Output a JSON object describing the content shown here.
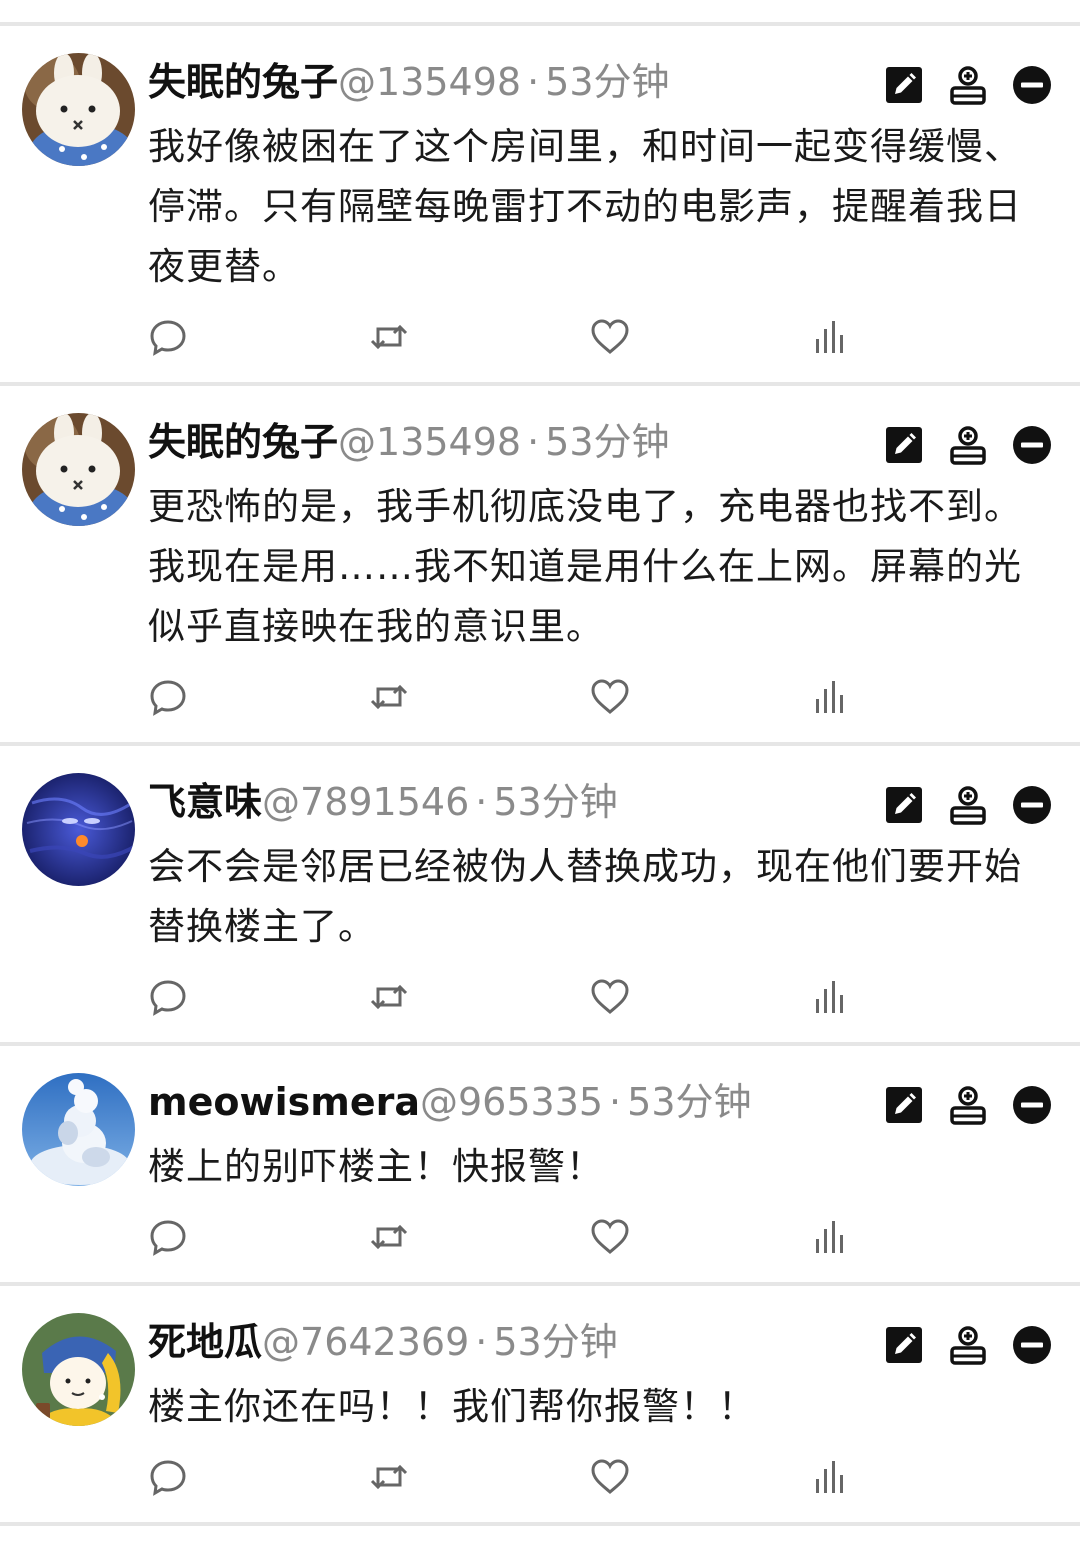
{
  "posts": [
    {
      "name": "失眠的兔子",
      "handle": "@135498",
      "dot": "·",
      "time": "53分钟",
      "text": "我好像被困在了这个房间里，和时间一起变得缓慢、停滞。只有隔壁每晚雷打不动的电影声，提醒着我日夜更替。",
      "avatar": "bunny-plush"
    },
    {
      "name": "失眠的兔子",
      "handle": "@135498",
      "dot": "·",
      "time": "53分钟",
      "text": "更恐怖的是，我手机彻底没电了，充电器也找不到。我现在是用……我不知道是用什么在上网。屏幕的光似乎直接映在我的意识里。",
      "avatar": "bunny-plush"
    },
    {
      "name": "飞意味",
      "handle": "@7891546",
      "dot": "·",
      "time": "53分钟",
      "text": "会不会是邻居已经被伪人替换成功，现在他们要开始替换楼主了。",
      "avatar": "blue-night-face"
    },
    {
      "name": "meowismera",
      "handle": "@965335",
      "dot": "·",
      "time": "53分钟",
      "text": "楼上的别吓楼主！快报警！",
      "avatar": "cloud-sky"
    },
    {
      "name": "死地瓜",
      "handle": "@7642369",
      "dot": "·",
      "time": "53分钟",
      "text": "楼主你还在吗！！我们帮你报警！！",
      "avatar": "pearl-earring-girl"
    }
  ],
  "icons": {
    "edit": "edit-icon",
    "follow": "add-user-icon",
    "block": "minus-circle-icon",
    "reply": "reply-icon",
    "repost": "repost-icon",
    "like": "heart-icon",
    "stats": "stats-icon"
  },
  "colors": {
    "icon": "#666666",
    "tool": "#111111",
    "divider": "#e6e6e6",
    "meta": "#8a8a8a"
  }
}
